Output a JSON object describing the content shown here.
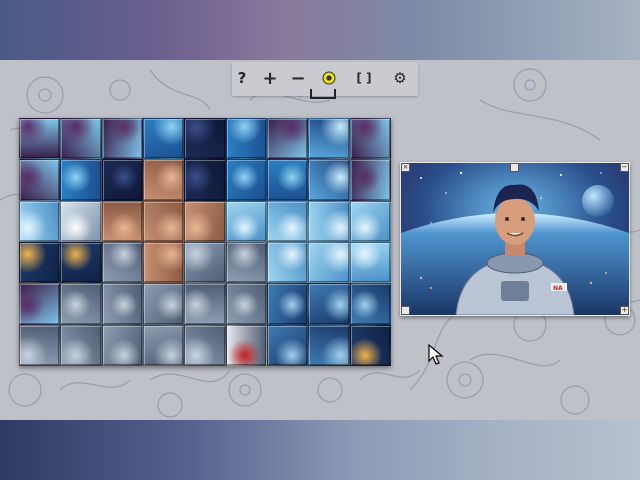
{
  "toolbar": {
    "buttons": [
      {
        "name": "help",
        "glyph": "?"
      },
      {
        "name": "zoom-in",
        "glyph": "+"
      },
      {
        "name": "zoom-out",
        "glyph": "−"
      },
      {
        "name": "toggle-preview",
        "glyph": "◉"
      },
      {
        "name": "fit-screen",
        "glyph": "[ ]"
      },
      {
        "name": "settings",
        "glyph": "⚙"
      }
    ]
  },
  "puzzle": {
    "rows": 6,
    "cols": 9,
    "tile_themes": [
      [
        "space",
        "space",
        "space",
        "sky",
        "hair",
        "sky",
        "space",
        "planet",
        "space"
      ],
      [
        "space",
        "sky",
        "hair",
        "face",
        "hair",
        "sky",
        "sky",
        "planet",
        "space"
      ],
      [
        "glow",
        "helmet",
        "face",
        "face",
        "face",
        "glow",
        "glow",
        "glow",
        "glow"
      ],
      [
        "city",
        "city",
        "suit",
        "face",
        "suit",
        "suit",
        "glow",
        "glow",
        "glow"
      ],
      [
        "space",
        "suit",
        "suit",
        "suit",
        "suit",
        "suit",
        "earth",
        "earth",
        "earth"
      ],
      [
        "suit",
        "suit",
        "suit",
        "suit",
        "suit",
        "patch",
        "earth",
        "earth",
        "city"
      ]
    ]
  },
  "preview": {
    "patch_text": "NA"
  },
  "colors": {
    "space": "#3a1d4a",
    "sky": "#2a7fc3",
    "glow": "#9fd6f0",
    "hair": "#1c2a55",
    "face": "#c99072",
    "helmet": "#d6e3ef",
    "suit": "#8f9eb3",
    "earth": "#3f7bb4",
    "city": "#1f3b6b",
    "planet": "#5aa8de",
    "patch": "#e8e8ee"
  }
}
